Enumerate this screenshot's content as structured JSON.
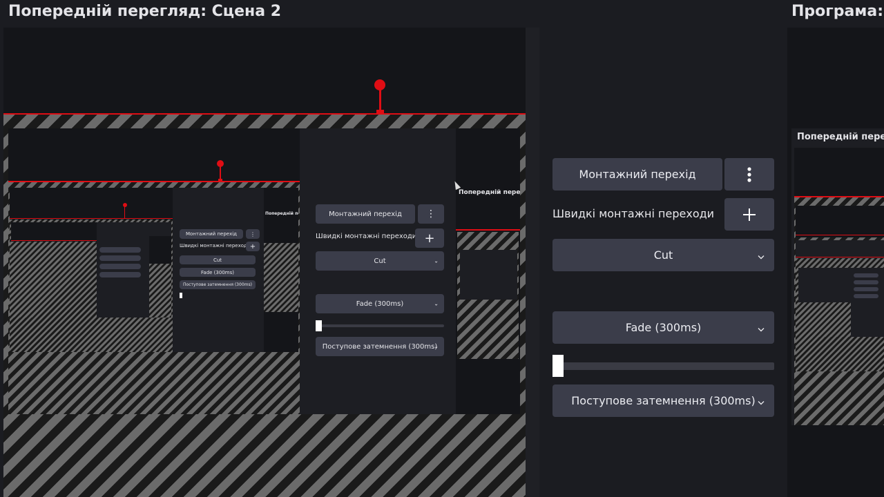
{
  "preview_title": "Попередній перегляд: Сцена 2",
  "program_title": "Програма:",
  "transitions": {
    "main_label": "Монтажний перехід",
    "more_icon": "kebab-vertical-icon",
    "quick_label": "Швидкі монтажні переходи",
    "add_icon": "plus-icon",
    "items": [
      "Cut",
      "Fade (300ms)",
      "Поступове затемнення (300ms)"
    ],
    "slider_value": 0
  },
  "nested_preview_title": "Попередній перегляд",
  "program_nested_title": "Попередній пере",
  "colors": {
    "background": "#1b1c21",
    "button": "#3b3d4a",
    "accent_red": "#e00d14",
    "stripe_light": "#6b6b6b",
    "stripe_dark": "#1a1a1a"
  }
}
